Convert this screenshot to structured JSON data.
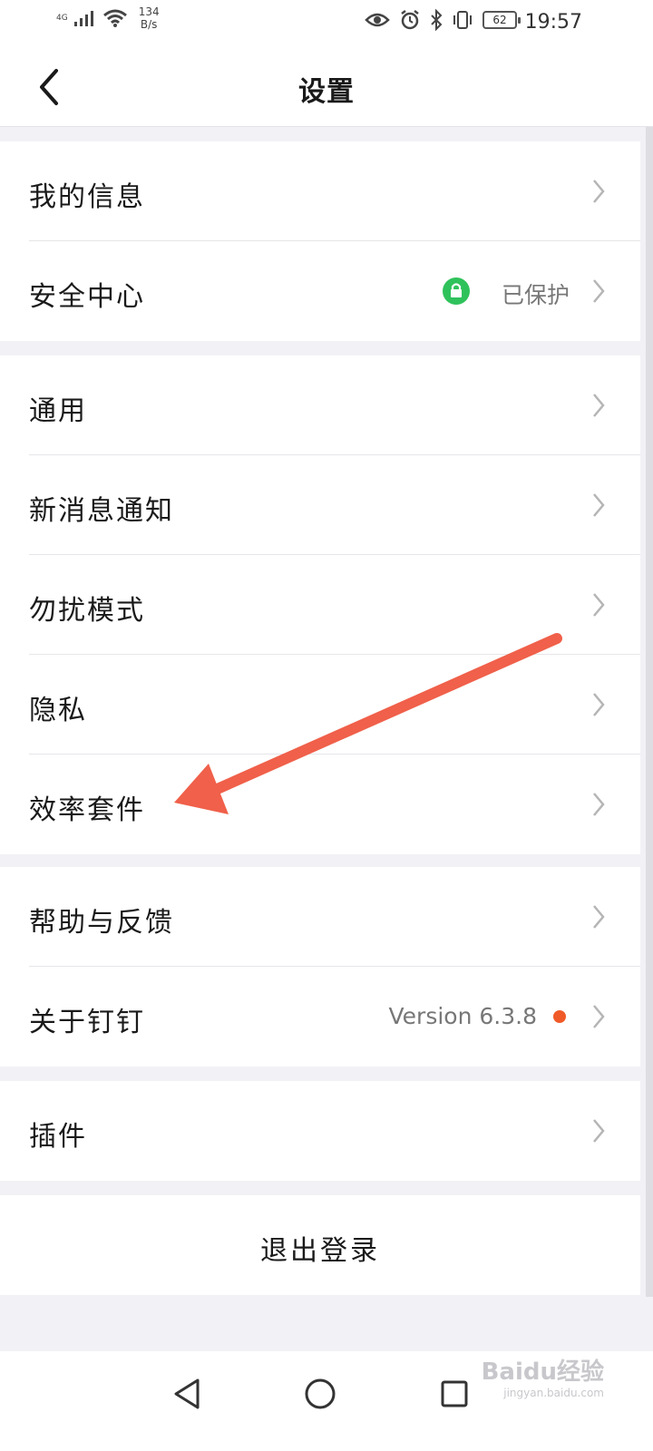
{
  "status_bar": {
    "network": "4G",
    "speed_value": "134",
    "speed_unit": "B/s",
    "battery": "62",
    "time": "19:57"
  },
  "header": {
    "title": "设置",
    "back_icon": "chevron-left-icon"
  },
  "groups": [
    {
      "items": [
        {
          "label": "我的信息"
        },
        {
          "label": "安全中心",
          "value": "已保护",
          "badge_icon": "lock-icon",
          "badge_color": "#2fc25b"
        }
      ]
    },
    {
      "items": [
        {
          "label": "通用"
        },
        {
          "label": "新消息通知"
        },
        {
          "label": "勿扰模式"
        },
        {
          "label": "隐私"
        },
        {
          "label": "效率套件"
        }
      ]
    },
    {
      "items": [
        {
          "label": "帮助与反馈"
        },
        {
          "label": "关于钉钉",
          "value": "Version 6.3.8",
          "dot_color": "#f05a28"
        }
      ]
    },
    {
      "items": [
        {
          "label": "插件"
        }
      ]
    }
  ],
  "logout": {
    "label": "退出登录"
  },
  "annotation": {
    "arrow_color": "#f0604a",
    "target": "效率套件"
  },
  "watermark": {
    "logo": "Baidu经验",
    "sub": "jingyan.baidu.com"
  },
  "colors": {
    "background": "#f2f2f6",
    "accent_green": "#2fc25b",
    "accent_orange": "#f05a28"
  }
}
